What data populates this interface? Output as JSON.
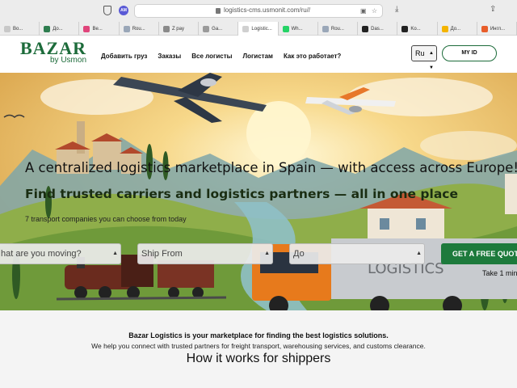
{
  "browser": {
    "url": "logistics-cms.usmonit.com/ru//",
    "ext_label": "AM",
    "tabs": [
      {
        "label": "Bo...",
        "color": "#c8c8c8"
      },
      {
        "label": "До...",
        "color": "#2e7d4f"
      },
      {
        "label": "Be...",
        "color": "#e0457b"
      },
      {
        "label": "Rou...",
        "color": "#9aa7b8"
      },
      {
        "label": "Z pay",
        "color": "#8a8a8a"
      },
      {
        "label": "Ga...",
        "color": "#9a9a9a"
      },
      {
        "label": "Logistic...",
        "color": "#d0d0d0",
        "active": true
      },
      {
        "label": "Wh...",
        "color": "#25d366"
      },
      {
        "label": "Rou...",
        "color": "#9aa7b8"
      },
      {
        "label": "Das...",
        "color": "#222222"
      },
      {
        "label": "Ko...",
        "color": "#222222"
      },
      {
        "label": "До...",
        "color": "#f4b400"
      },
      {
        "label": "Ингл...",
        "color": "#e85d2a"
      }
    ]
  },
  "header": {
    "logo_main": "BAZAR",
    "logo_sub": "by Usmon",
    "nav": [
      "Добавить груз",
      "Заказы",
      "Все логисты",
      "Логистам",
      "Как это работает?"
    ],
    "language": "Ru",
    "myid_label": "MY ID"
  },
  "hero": {
    "headline": "A centralized logistics marketplace in Spain — with access across Europe!",
    "subline": "Find trusted carriers and logistics partners — all in one place",
    "companies_text": "7 transport companies you can choose from today",
    "cargo_placeholder": "hat are you moving?",
    "from_placeholder": "Ship From",
    "to_placeholder": "До",
    "cta_label": "GET A FREE QUOTE",
    "take_text": "Take 1 minu",
    "truck_lettering": "LOGISTICS"
  },
  "info": {
    "title": "Bazar Logistics is your marketplace for finding the best logistics solutions.",
    "text": "We help you connect with trusted partners for freight transport, warehousing services, and customs clearance.",
    "heading": "How it works for shippers"
  },
  "colors": {
    "brand_green": "#1c6b3a",
    "cta_green": "#1d7a3c"
  }
}
